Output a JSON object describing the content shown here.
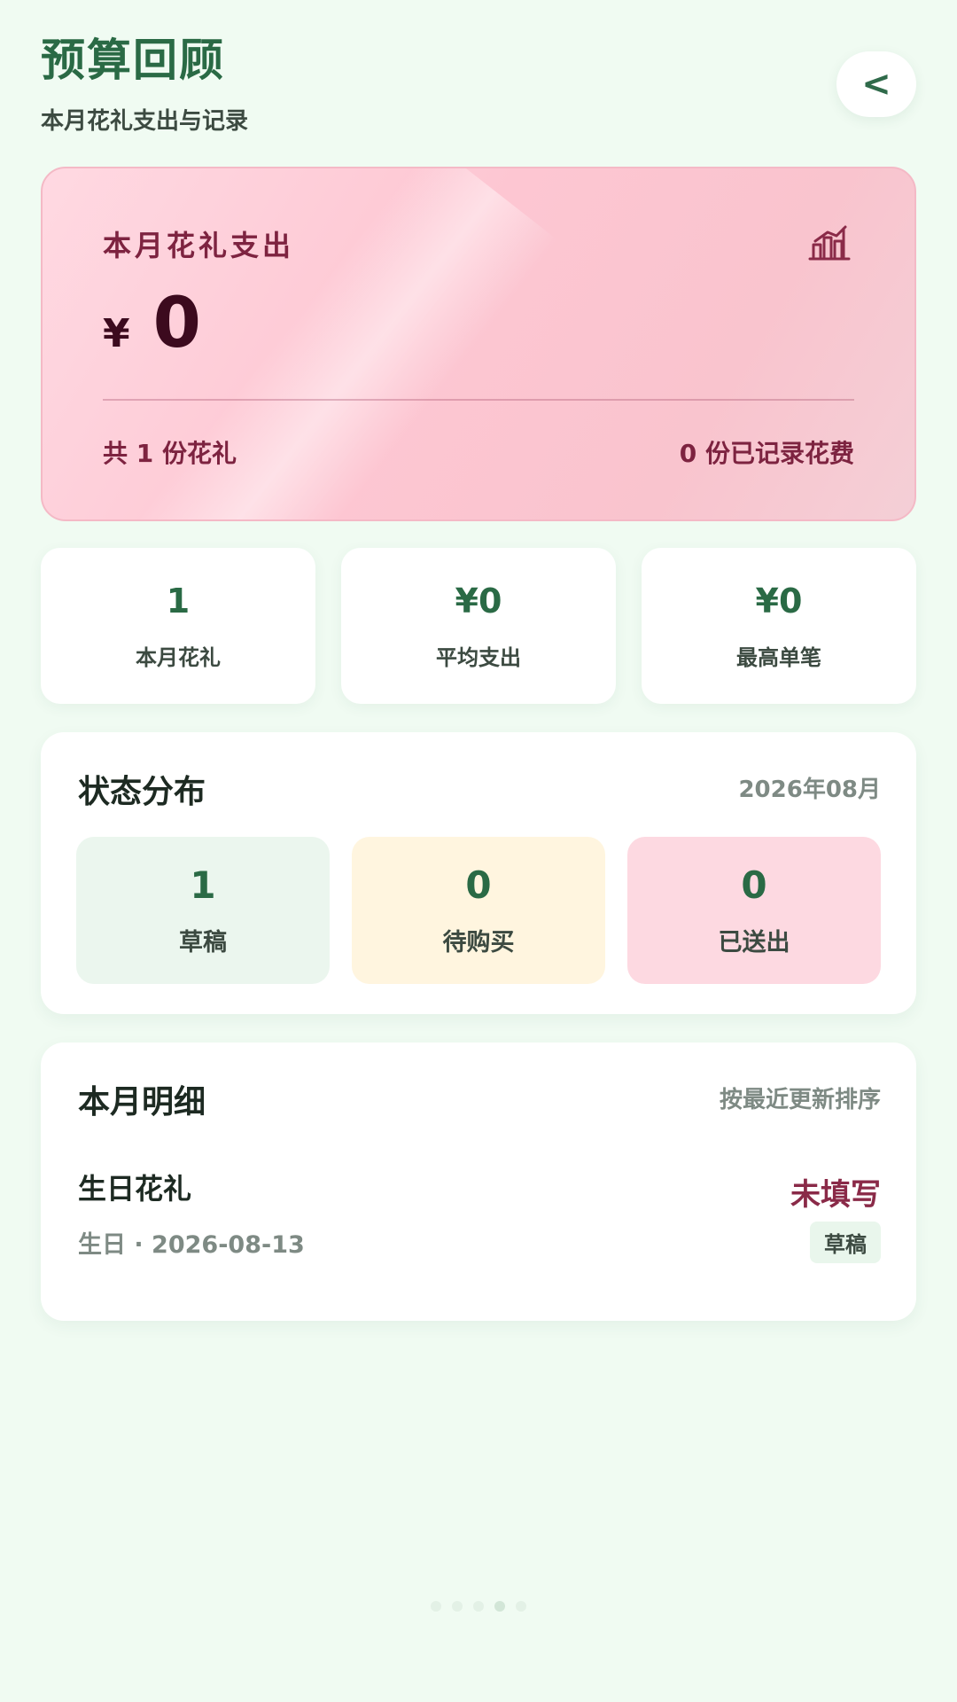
{
  "header": {
    "title": "预算回顾",
    "subtitle": "本月花礼支出与记录",
    "back_label": "<"
  },
  "hero": {
    "label": "本月花礼支出",
    "icon": "bar-chart-icon",
    "currency": "¥",
    "amount": "0",
    "gift_count": "共 1 份花礼",
    "recorded_count": "0 份已记录花费",
    "colors": {
      "background": "#fdc6d2",
      "text": "#7d2340"
    }
  },
  "stats": [
    {
      "value": "1",
      "label": "本月花礼"
    },
    {
      "value": "¥0",
      "label": "平均支出"
    },
    {
      "value": "¥0",
      "label": "最高单笔"
    }
  ],
  "status": {
    "title": "状态分布",
    "period": "2026年08月",
    "tiles": [
      {
        "value": "1",
        "label": "草稿",
        "color": "#ebf6ee"
      },
      {
        "value": "0",
        "label": "待购买",
        "color": "#fff5df"
      },
      {
        "value": "0",
        "label": "已送出",
        "color": "#fdd9e1"
      }
    ]
  },
  "details": {
    "title": "本月明细",
    "sort_label": "按最近更新排序",
    "items": [
      {
        "title": "生日花礼",
        "subtitle": "生日 · 2026-08-13",
        "amount": "未填写",
        "status": "草稿"
      }
    ]
  },
  "pager": {
    "count": 5,
    "active_index": 3
  }
}
